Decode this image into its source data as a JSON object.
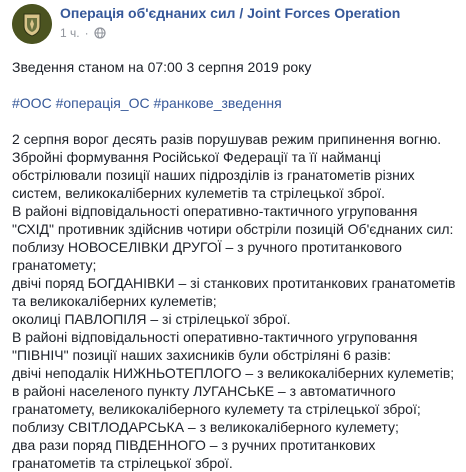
{
  "post": {
    "author": "Операція об'єднаних сил / Joint Forces Operation",
    "time": "1 ч.",
    "privacy_icon": "globe-icon",
    "headline": "Зведення станом на 07:00 3 серпня 2019 року",
    "hashtags": [
      "#ООС",
      "#операція_ОС",
      "#ранкове_зведення"
    ],
    "lines": [
      "2 серпня ворог десять разів порушував режим припинення вогню.",
      "Збройні формування Російської Федерації та її найманці",
      "обстрілювали позиції наших підрозділів із гранатометів різних",
      "систем, великокаліберних кулеметів та стрілецької зброї.",
      "В районі відповідальності оперативно-тактичного угруповання",
      "\"СХІД\" противник здійснив чотири обстріли позицій Об'єднаних сил:",
      "поблизу НОВОСЕЛІВКИ ДРУГОЇ – з ручного протитанкового",
      "гранатомету;",
      "двічі поряд БОГДАНІВКИ – зі станкових протитанкових гранатометів",
      "та великокаліберних кулеметів;",
      "околиці ПАВЛОПІЛЯ – зі стрілецької зброї.",
      "В районі відповідальності оперативно-тактичного угруповання",
      "\"ПІВНІЧ\" позиції наших захисників були обстріляні 6 разів:",
      "двічі неподалік НИЖНЬОТЕПЛОГО – з великокаліберних кулеметів;",
      "в районі населеного пункту ЛУГАНСЬКЕ – з автоматичного",
      "гранатомету, великокаліберного кулемету та стрілецької зброї;",
      "поблизу СВІТЛОДАРСЬКА – з великокаліберного кулемету;",
      "два рази поряд ПІВДЕННОГО – з ручних протитанкових",
      "гранатометів та стрілецької зброї."
    ]
  },
  "colors": {
    "link": "#365899",
    "text": "#1d2129",
    "meta": "#90949c",
    "avatar_bg": "#4b5320"
  }
}
